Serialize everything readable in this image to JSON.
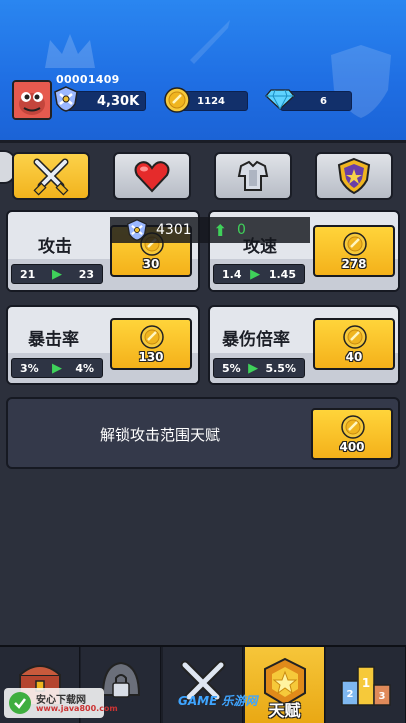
{
  "player": {
    "id": "00001409",
    "power": "4,30K",
    "coins": "1124",
    "gems": "6"
  },
  "tabs": [
    {
      "name": "swords",
      "active": true
    },
    {
      "name": "heart",
      "active": false
    },
    {
      "name": "armor",
      "active": false
    },
    {
      "name": "shield",
      "active": false
    }
  ],
  "upgrades": [
    {
      "title": "攻击",
      "from": "21",
      "to": "23",
      "price": "30"
    },
    {
      "title": "攻速",
      "from": "1.4",
      "to": "1.45",
      "price": "278"
    },
    {
      "title": "暴击率",
      "from": "3%",
      "to": "4%",
      "price": "130"
    },
    {
      "title": "暴伤倍率",
      "from": "5%",
      "to": "5.5%",
      "price": "40"
    }
  ],
  "unlock": {
    "label": "解锁攻击范围天赋",
    "price": "400"
  },
  "toast": {
    "value": "4301",
    "delta": "0"
  },
  "nav": {
    "active_label": "天赋"
  },
  "watermarks": {
    "left_line1": "安心下载网",
    "left_line2": "www.java800.com",
    "mid": "GAME 乐游网"
  }
}
